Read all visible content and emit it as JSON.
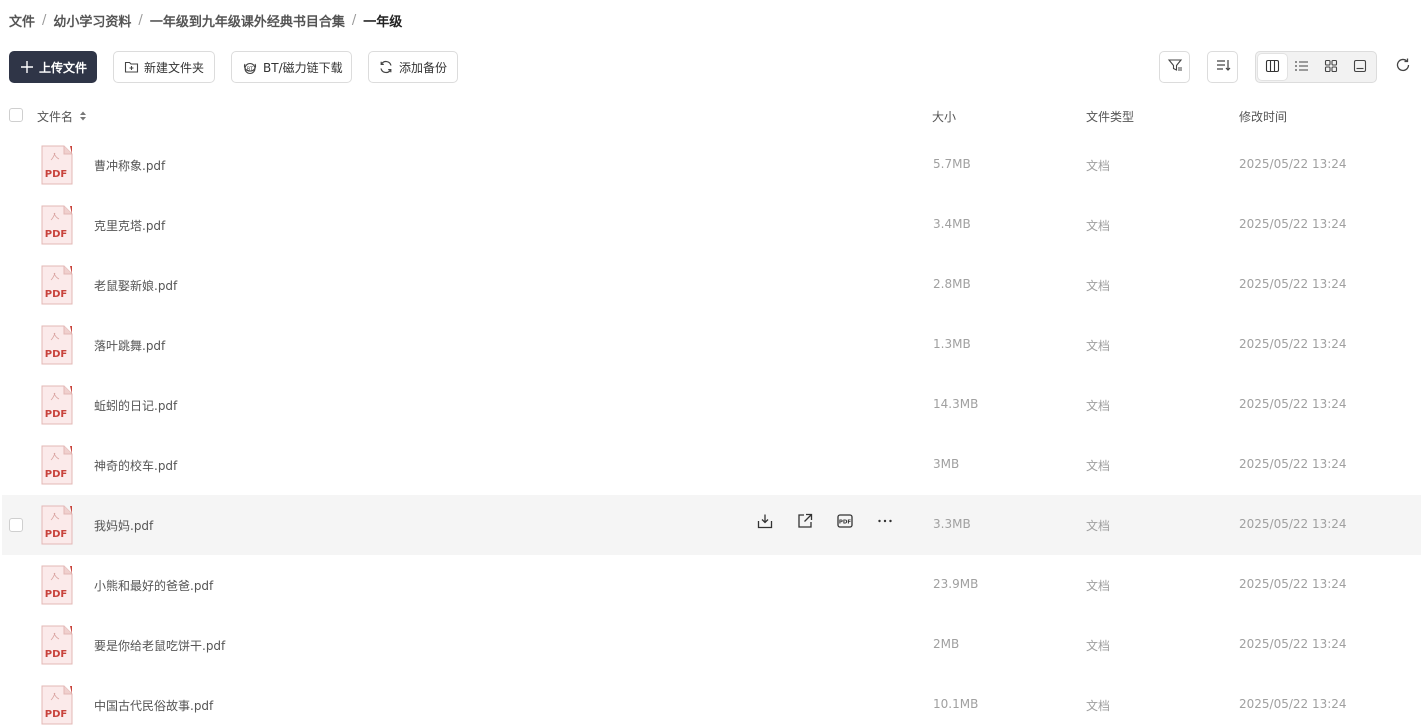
{
  "breadcrumb": [
    "文件",
    "幼小学习资料",
    "一年级到九年级课外经典书目合集",
    "一年级"
  ],
  "toolbar": {
    "upload_label": "上传文件",
    "new_folder_label": "新建文件夹",
    "bt_label": "BT/磁力链下载",
    "backup_label": "添加备份"
  },
  "table": {
    "columns": {
      "name": "文件名",
      "size": "大小",
      "type": "文件类型",
      "modified": "修改时间"
    },
    "file_icon_label": "PDF",
    "rows": [
      {
        "name": "曹冲称象.pdf",
        "size": "5.7MB",
        "type": "文档",
        "modified": "2025/05/22 13:24"
      },
      {
        "name": "克里克塔.pdf",
        "size": "3.4MB",
        "type": "文档",
        "modified": "2025/05/22 13:24"
      },
      {
        "name": "老鼠娶新娘.pdf",
        "size": "2.8MB",
        "type": "文档",
        "modified": "2025/05/22 13:24"
      },
      {
        "name": "落叶跳舞.pdf",
        "size": "1.3MB",
        "type": "文档",
        "modified": "2025/05/22 13:24"
      },
      {
        "name": "蚯蚓的日记.pdf",
        "size": "14.3MB",
        "type": "文档",
        "modified": "2025/05/22 13:24"
      },
      {
        "name": "神奇的校车.pdf",
        "size": "3MB",
        "type": "文档",
        "modified": "2025/05/22 13:24"
      },
      {
        "name": "我妈妈.pdf",
        "size": "3.3MB",
        "type": "文档",
        "modified": "2025/05/22 13:24"
      },
      {
        "name": "小熊和最好的爸爸.pdf",
        "size": "23.9MB",
        "type": "文档",
        "modified": "2025/05/22 13:24"
      },
      {
        "name": "要是你给老鼠吃饼干.pdf",
        "size": "2MB",
        "type": "文档",
        "modified": "2025/05/22 13:24"
      },
      {
        "name": "中国古代民俗故事.pdf",
        "size": "10.1MB",
        "type": "文档",
        "modified": "2025/05/22 13:24"
      }
    ]
  },
  "icons": {
    "upload": "plus-icon",
    "new_folder": "folder-plus-icon",
    "bt": "bt-icon",
    "backup": "sync-icon",
    "filter": "filter-icon",
    "sort": "sort-icon",
    "views": [
      "columns-view-icon",
      "list-view-icon",
      "grid-view-icon",
      "preview-view-icon"
    ],
    "refresh": "refresh-icon",
    "row_actions": [
      "download-icon",
      "share-icon",
      "pdf-convert-icon",
      "more-icon"
    ]
  },
  "colors": {
    "primary_button": "#2f3547",
    "pdf_red": "#c8423b",
    "hover_row": "#f5f5f5"
  }
}
